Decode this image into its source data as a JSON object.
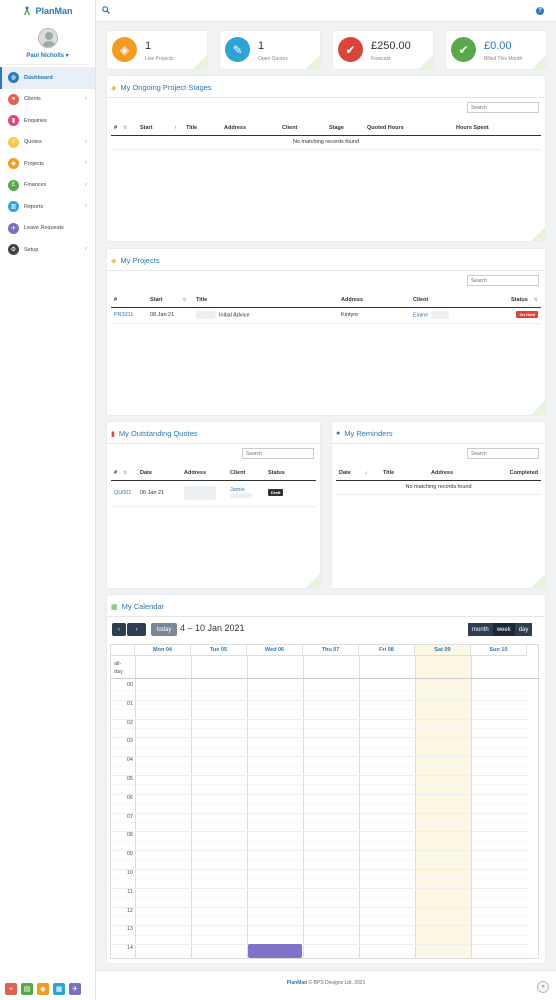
{
  "app": {
    "name": "PlanMan"
  },
  "user": {
    "name": "Paul Nicholls",
    "caret": "▾"
  },
  "sidebar": {
    "items": [
      {
        "label": "Dashboard",
        "icon": "dashboard-icon",
        "color": "#2c78b9",
        "glyph": "◍"
      },
      {
        "label": "Clients",
        "icon": "clients-icon",
        "color": "#e0624f",
        "glyph": "●"
      },
      {
        "label": "Enquiries",
        "icon": "enquiries-icon",
        "color": "#e0457b",
        "glyph": "▮"
      },
      {
        "label": "Quotes",
        "icon": "quotes-icon",
        "color": "#f4c94e",
        "glyph": "≡"
      },
      {
        "label": "Projects",
        "icon": "projects-icon",
        "color": "#f39c24",
        "glyph": "◆"
      },
      {
        "label": "Finances",
        "icon": "finances-icon",
        "color": "#5aa84c",
        "glyph": "£"
      },
      {
        "label": "Reports",
        "icon": "reports-icon",
        "color": "#2ea3d8",
        "glyph": "▥"
      },
      {
        "label": "Leave Requests",
        "icon": "leave-icon",
        "color": "#7a6fbf",
        "glyph": "✈"
      },
      {
        "label": "Setup",
        "icon": "setup-icon",
        "color": "#444",
        "glyph": "⚙"
      }
    ],
    "quick_actions": [
      {
        "icon": "add-client-icon",
        "color": "#e0624f",
        "glyph": "+"
      },
      {
        "icon": "add-quote-icon",
        "color": "#5aa84c",
        "glyph": "▤"
      },
      {
        "icon": "add-project-icon",
        "color": "#f39c24",
        "glyph": "◆"
      },
      {
        "icon": "add-document-icon",
        "color": "#2ea3d8",
        "glyph": "▦"
      },
      {
        "icon": "add-leave-icon",
        "color": "#7a6fbf",
        "glyph": "✈"
      }
    ]
  },
  "topbar": {
    "help": "?"
  },
  "stats": [
    {
      "value": "1",
      "label": "Live Projects",
      "color": "#f39c24",
      "glyph": "◈"
    },
    {
      "value": "1",
      "label": "Open Quotes",
      "color": "#2ea3d8",
      "glyph": "✎"
    },
    {
      "value": "£250.00",
      "label": "Forecast",
      "color": "#d9443b",
      "glyph": "✔"
    },
    {
      "value": "£0.00",
      "label": "Billed This Month",
      "color": "#5aa84c",
      "glyph": "✔"
    }
  ],
  "stages": {
    "title": "My Ongoing Project Stages",
    "search_placeholder": "Search",
    "columns": [
      "#",
      "Start",
      "Title",
      "Address",
      "Client",
      "Stage",
      "Quoted Hours",
      "Hours Spent"
    ],
    "empty": "No matching records found"
  },
  "projects": {
    "title": "My Projects",
    "search_placeholder": "Search",
    "columns": [
      "#",
      "Start",
      "Title",
      "Address",
      "Client",
      "Status"
    ],
    "rows": [
      {
        "id": "PR3211",
        "start": "08 Jan 21",
        "title": "Initial Advice",
        "address": "Kintyre",
        "client": "Elaine",
        "status": "On Hold",
        "status_color": "#d9443b"
      }
    ]
  },
  "quotes": {
    "title": "My Outstanding Quotes",
    "search_placeholder": "Search",
    "columns": [
      "#",
      "Date",
      "Address",
      "Client",
      "Status"
    ],
    "rows": [
      {
        "id": "QU001",
        "date": "06 Jan 21",
        "client": "Jamie",
        "status": "Draft",
        "status_color": "#333"
      }
    ]
  },
  "reminders": {
    "title": "My Reminders",
    "search_placeholder": "Search",
    "columns": [
      "Date",
      "Title",
      "Address",
      "Completed"
    ],
    "empty": "No matching records found"
  },
  "calendar": {
    "title": "My Calendar",
    "range": "4 – 10 Jan 2021",
    "today_label": "today",
    "prev": "‹",
    "next": "›",
    "views": [
      "month",
      "week",
      "day"
    ],
    "days": [
      "Mon 04",
      "Tue 05",
      "Wed 06",
      "Thu 07",
      "Fri 08",
      "Sat 09",
      "Sun 10"
    ],
    "allday_label": "all-\nday",
    "hours": [
      "00",
      "01",
      "02",
      "03",
      "04",
      "05",
      "06",
      "07",
      "08",
      "09",
      "10",
      "11",
      "12",
      "13",
      "14"
    ],
    "today_index": 5,
    "event": {
      "day_index": 2,
      "start_hour": 14.0,
      "end_hour": 15.0,
      "color": "#7e73c6"
    }
  },
  "footer": {
    "brand": "PlanMan",
    "text": "© BPS Designs Ltd. 2021",
    "scroll_top": "«"
  }
}
